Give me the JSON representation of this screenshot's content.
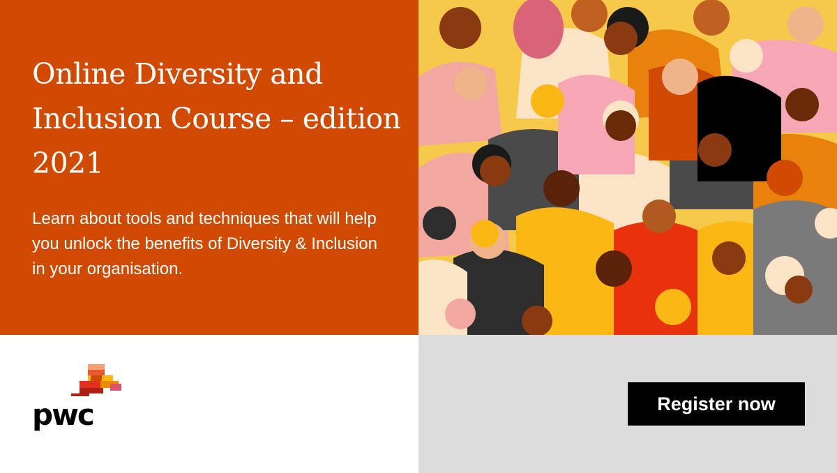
{
  "banner": {
    "title": "Online Diversity and Inclusion Course – edition 2021",
    "subtitle": "Learn about tools and techniques that will help you unlock the benefits of Diversity & Inclusion in your organisation.",
    "register_label": "Register now"
  },
  "brand": {
    "logo_text": "pwc",
    "logo_icon": "pwc-logo-blocks"
  },
  "colors": {
    "primary_orange": "#d04a02",
    "button_black": "#000000",
    "grey_panel": "#dcdcdc",
    "white_panel": "#ffffff"
  },
  "illustration": {
    "icon": "crowd-illustration"
  }
}
